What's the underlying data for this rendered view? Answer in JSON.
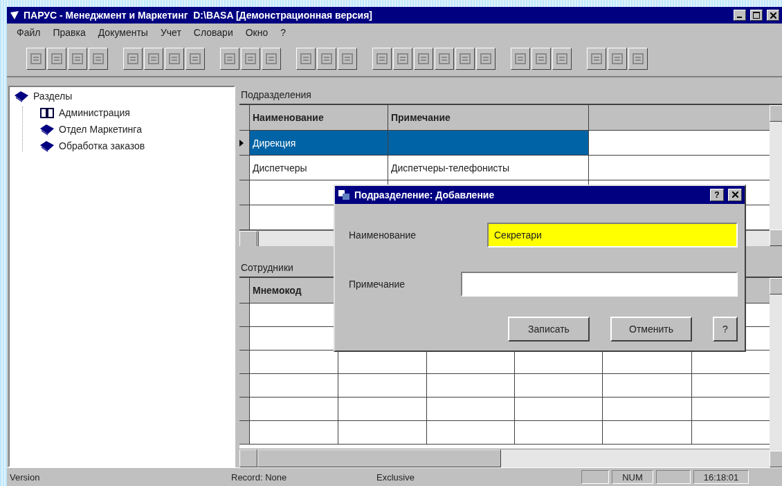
{
  "window": {
    "title": "ПАРУС - Менеджмент и Маркетинг  D:\\BASA [Демонстрационная версия]"
  },
  "menu": [
    "Файл",
    "Правка",
    "Документы",
    "Учет",
    "Словари",
    "Окно",
    "?"
  ],
  "tree": {
    "label": "Разделы",
    "children": [
      {
        "label": "Администрация",
        "kind": "open"
      },
      {
        "label": "Отдел Маркетинга",
        "kind": "closed"
      },
      {
        "label": "Обработка заказов",
        "kind": "closed"
      }
    ]
  },
  "top_panel": {
    "title": "Подразделения",
    "columns": [
      "Наименование",
      "Примечание"
    ],
    "rows": [
      {
        "cells": [
          "Дирекция",
          null
        ],
        "selected": true
      },
      {
        "cells": [
          "Диспетчеры",
          "Диспетчеры-телефонисты"
        ],
        "selected": false
      }
    ]
  },
  "bottom_panel": {
    "title": "Сотрудники",
    "columns": [
      "Мнемокод"
    ]
  },
  "dialog": {
    "title": "Подразделение: Добавление",
    "title_buttons": [
      "?"
    ],
    "fields": [
      {
        "label": "Наименование",
        "value": "Секретари",
        "focused": true
      },
      {
        "label": "Примечание",
        "focused": false
      }
    ],
    "buttons": [
      "Записать",
      "Отменить",
      "?"
    ]
  },
  "status_bar": [
    "Version",
    "Record: None",
    "Exclusive",
    "NUM",
    "16:18:01"
  ]
}
